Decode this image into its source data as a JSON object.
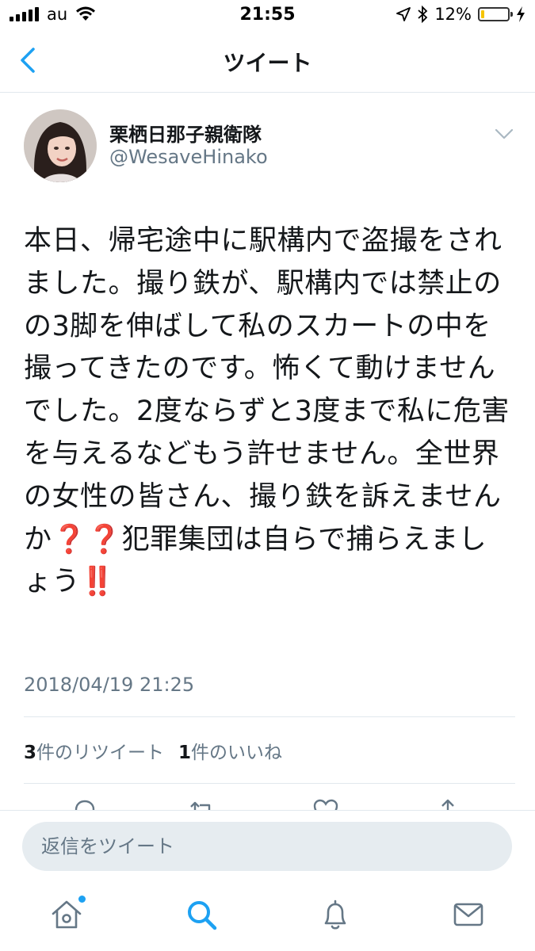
{
  "status_bar": {
    "carrier": "au",
    "time": "21:55",
    "battery_percent": "12%",
    "battery_level": 0.12
  },
  "nav": {
    "title": "ツイート"
  },
  "tweet": {
    "display_name": "栗栖日那子親衛隊",
    "username": "@WesaveHinako",
    "text": "本日、帰宅途中に駅構内で盗撮をされました。撮り鉄が、駅構内では禁止のの3脚を伸ばして私のスカートの中を撮ってきたのです。怖くて動けませんでした。2度ならずと3度まで私に危害を与えるなどもう許せません。全世界の女性の皆さん、撮り鉄を訴えませんか❓❓犯罪集団は自らで捕らえましょう‼️",
    "timestamp": "2018/04/19 21:25",
    "retweet_count": "3",
    "retweet_label": "件のリツイート",
    "like_count": "1",
    "like_label": "件のいいね"
  },
  "reply": {
    "placeholder": "返信をツイート"
  },
  "colors": {
    "accent": "#1da1f2",
    "secondary_text": "#657786",
    "divider": "#e1e8ed"
  },
  "tabs": [
    {
      "name": "home-icon",
      "notification_dot": true
    },
    {
      "name": "search-icon"
    },
    {
      "name": "notifications-icon"
    },
    {
      "name": "messages-icon"
    }
  ]
}
